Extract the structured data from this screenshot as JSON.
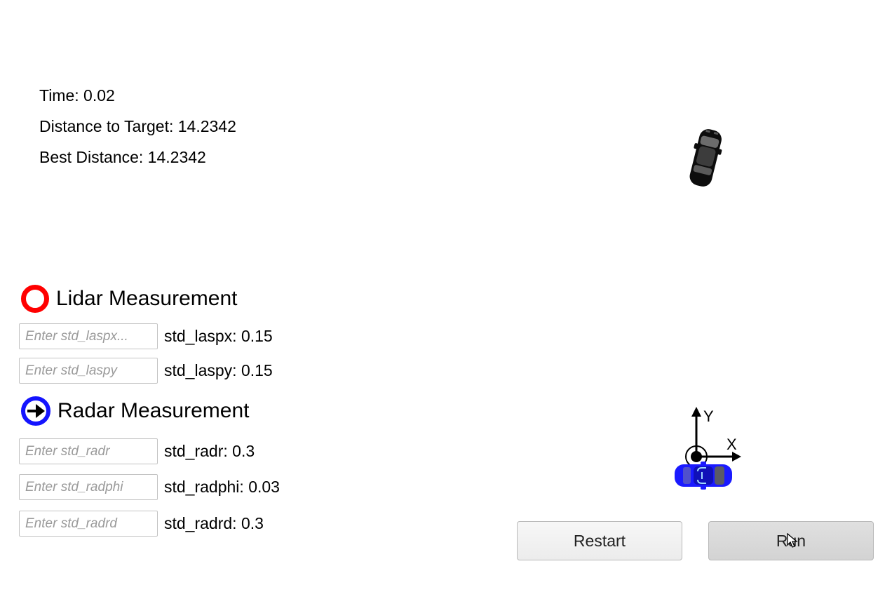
{
  "stats": {
    "time": "Time: 0.02",
    "distance": "Distance to Target: 14.2342",
    "best": "Best Distance: 14.2342"
  },
  "lidar": {
    "title": "Lidar Measurement",
    "inputs": [
      {
        "placeholder": "Enter std_laspx...",
        "value_label": "std_laspx: 0.15"
      },
      {
        "placeholder": "Enter std_laspy",
        "value_label": "std_laspy: 0.15"
      }
    ]
  },
  "radar": {
    "title": "Radar Measurement",
    "inputs": [
      {
        "placeholder": "Enter std_radr",
        "value_label": "std_radr: 0.3"
      },
      {
        "placeholder": "Enter std_radphi",
        "value_label": "std_radphi: 0.03"
      },
      {
        "placeholder": "Enter std_radrd",
        "value_label": "std_radrd: 0.3"
      }
    ]
  },
  "axes": {
    "y_label": "Y",
    "x_label": "X"
  },
  "buttons": {
    "restart": "Restart",
    "run": "Run"
  },
  "colors": {
    "lidar_marker": "#ff0000",
    "radar_marker": "#1414ff",
    "target_car": "#111111",
    "ego_car": "#1a1aff"
  },
  "icons": {
    "lidar": "red-ring-icon",
    "radar": "blue-ring-arrow-icon",
    "target": "black-car-icon",
    "ego": "blue-car-icon",
    "cursor": "mouse-pointer-icon"
  }
}
